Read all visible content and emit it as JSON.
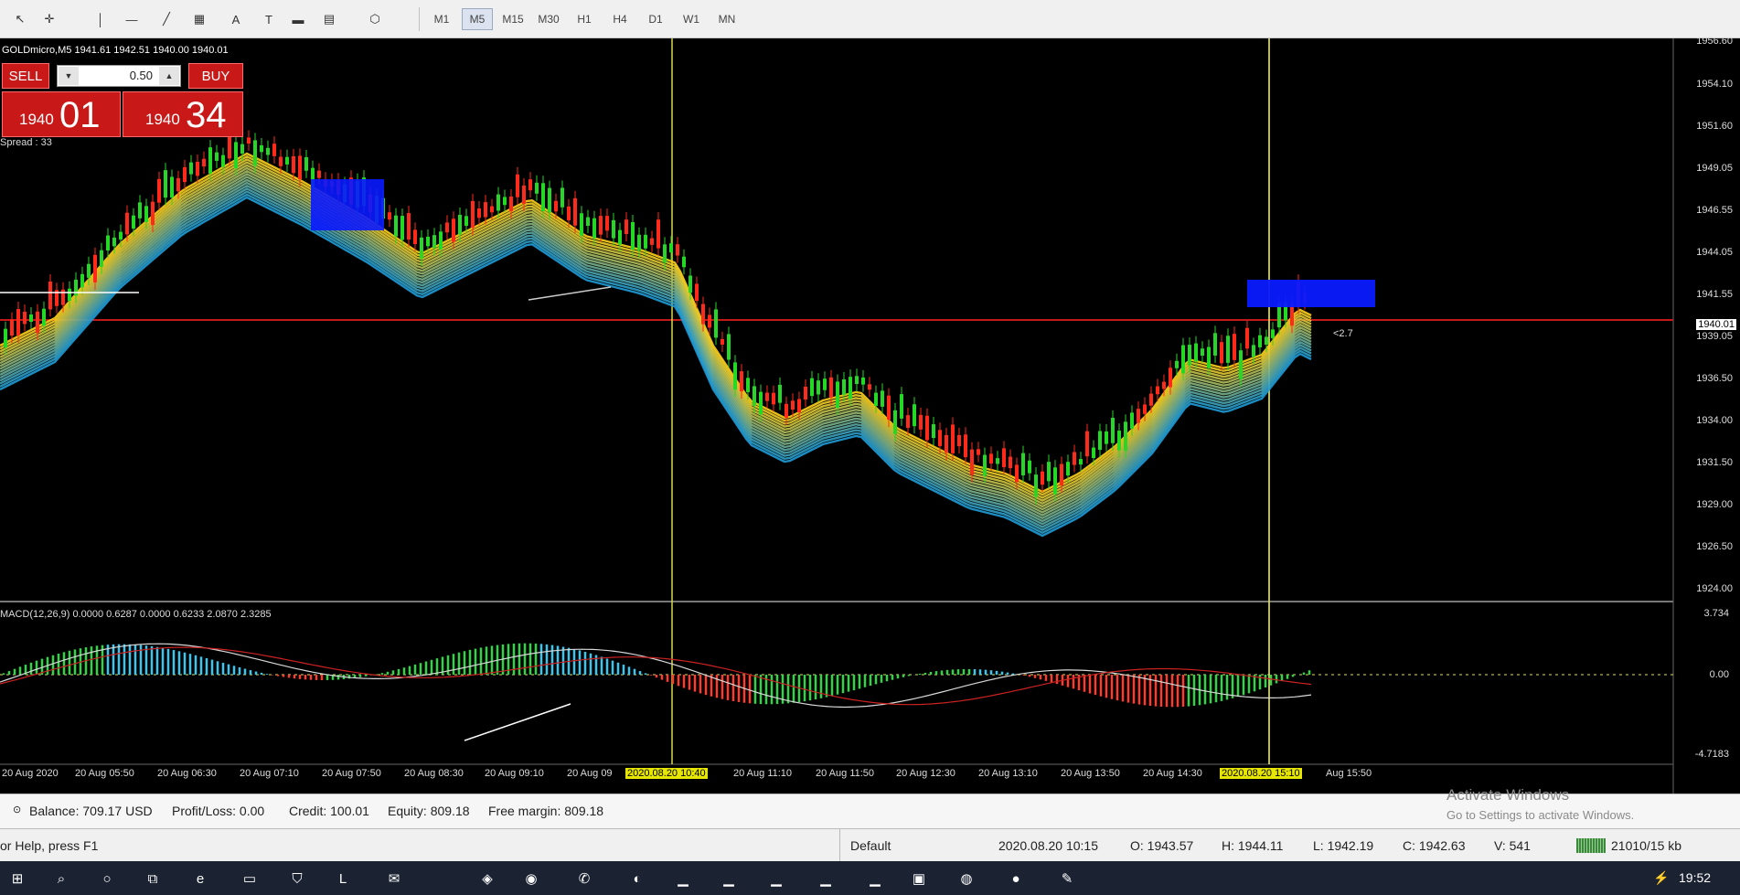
{
  "toolbar": {
    "tools": [
      {
        "name": "cursor-icon",
        "glyph": "↖"
      },
      {
        "name": "crosshair-icon",
        "glyph": "✛"
      },
      {
        "name": "vertical-line-icon",
        "glyph": "│"
      },
      {
        "name": "horizontal-line-icon",
        "glyph": "—"
      },
      {
        "name": "trendline-icon",
        "glyph": "╱"
      },
      {
        "name": "channel-icon",
        "glyph": "▦"
      },
      {
        "name": "text-icon",
        "glyph": "A"
      },
      {
        "name": "text-label-icon",
        "glyph": "T"
      },
      {
        "name": "rectangle-icon",
        "glyph": "▬"
      },
      {
        "name": "fibonacci-icon",
        "glyph": "▤"
      },
      {
        "name": "shapes-icon",
        "glyph": "⬡"
      }
    ],
    "timeframes": [
      "M1",
      "M5",
      "M15",
      "M30",
      "H1",
      "H4",
      "D1",
      "W1",
      "MN"
    ],
    "active_timeframe": "M5"
  },
  "chart": {
    "symbol_info": "GOLDmicro,M5  1941.61 1942.51 1940.00 1940.01",
    "trade_panel": {
      "sell_label": "SELL",
      "buy_label": "BUY",
      "lot": "0.50",
      "sell_small": "1940",
      "sell_big": "01",
      "buy_small": "1940",
      "buy_big": "34",
      "spread": "Spread : 33"
    },
    "price_axis": [
      "1956.60",
      "1954.10",
      "1951.60",
      "1949.05",
      "1946.55",
      "1944.05",
      "1941.55",
      "1939.05",
      "1936.50",
      "1934.00",
      "1931.50",
      "1929.00",
      "1926.50",
      "1924.00"
    ],
    "current_price": "1940.01",
    "order_label": "<2.7",
    "macd_info": "MACD(12,26,9) 0.0000 0.6287 0.0000 0.6233 2.0870 2.3285",
    "macd_scale": [
      "3.734",
      "0.00",
      "-4.7183"
    ],
    "time_axis": [
      "20 Aug 2020",
      "20 Aug 05:50",
      "20 Aug 06:30",
      "20 Aug 07:10",
      "20 Aug 07:50",
      "20 Aug 08:30",
      "20 Aug 09:10",
      "20 Aug 09",
      "2020.08.20 10:40",
      "20 Aug 11:10",
      "20 Aug 11:50",
      "20 Aug 12:30",
      "20 Aug 13:10",
      "20 Aug 13:50",
      "20 Aug 14:30",
      "2020.08.20 15:10",
      "Aug 15:50"
    ],
    "colors": {
      "up": "#26d826",
      "down": "#ff2a1a",
      "ribbon_warm": "#ffd11a",
      "ribbon_cool": "#1f9bd6",
      "box": "#0a1aff",
      "crosshair": "#d8d84a",
      "macd_pos": "#39c6ef",
      "macd_neg": "#ff3b2b",
      "macd_green": "#2fd44a"
    }
  },
  "account": {
    "balance": "Balance: 709.17 USD",
    "profit": "Profit/Loss: 0.00",
    "credit": "Credit: 100.01",
    "equity": "Equity: 809.18",
    "free_margin": "Free margin: 809.18"
  },
  "status": {
    "help": "or Help, press F1",
    "profile": "Default",
    "datetime": "2020.08.20 10:15",
    "open": "O: 1943.57",
    "high": "H: 1944.11",
    "low": "L: 1942.19",
    "close": "C: 1942.63",
    "volume": "V: 541",
    "traffic": "21010/15 kb"
  },
  "watermark": {
    "title": "Activate Windows",
    "subtitle": "Go to Settings to activate Windows."
  },
  "taskbar": {
    "clock": "19:52"
  }
}
